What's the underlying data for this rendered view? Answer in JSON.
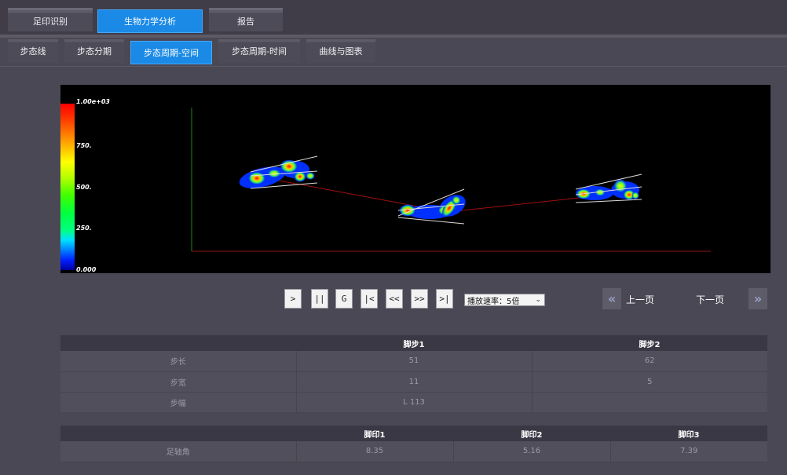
{
  "main_tabs": [
    {
      "label": "足印识别",
      "active": false
    },
    {
      "label": "生物力学分析",
      "active": true
    },
    {
      "label": "报告",
      "active": false
    }
  ],
  "sub_tabs": [
    {
      "label": "步态线",
      "active": false
    },
    {
      "label": "步态分期",
      "active": false
    },
    {
      "label": "步态周期-空间",
      "active": true
    },
    {
      "label": "步态周期-时间",
      "active": false
    },
    {
      "label": "曲线与图表",
      "active": false
    }
  ],
  "colorbar": {
    "labels": [
      "1.00e+03",
      "750.",
      "500.",
      "250.",
      "0.000"
    ]
  },
  "playback": {
    "play": ">",
    "pause": "||",
    "reset": "G",
    "first": "|<",
    "prev": "<<",
    "next": ">>",
    "last": ">|",
    "speed_label": "播放速率：5倍"
  },
  "pager": {
    "prev_icon": "«",
    "prev_label": "上一页",
    "next_label": "下一页",
    "next_icon": "»"
  },
  "steps_table": {
    "headers": [
      "",
      "脚步1",
      "脚步2"
    ],
    "rows": [
      {
        "label": "步长",
        "v1": "51",
        "v2": "62"
      },
      {
        "label": "步宽",
        "v1": "11",
        "v2": "5"
      },
      {
        "label": "步幅",
        "v1": "L  113",
        "v2": ""
      }
    ]
  },
  "prints_table": {
    "headers": [
      "",
      "脚印1",
      "脚印2",
      "脚印3"
    ],
    "rows": [
      {
        "label": "足轴角",
        "v1": "8.35",
        "v2": "5.16",
        "v3": "7.39"
      }
    ]
  },
  "colors": {
    "accent": "#1a8ae6",
    "background": "#4b4855",
    "header_row": "#3a3844",
    "cell": "#524f5c"
  }
}
